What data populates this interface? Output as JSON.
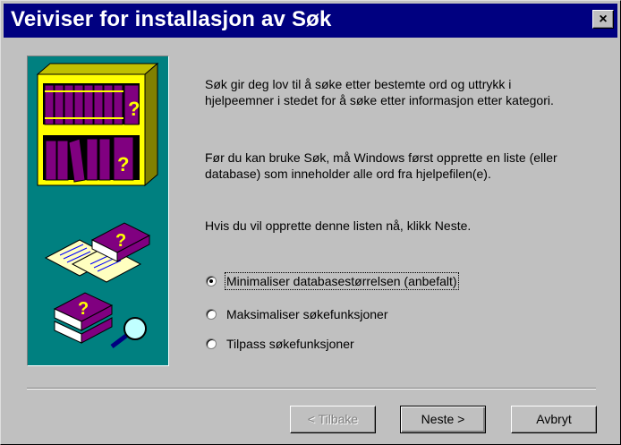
{
  "window": {
    "title": "Veiviser for installasjon av Søk",
    "close_symbol": "×"
  },
  "intro": {
    "paragraph1": "Søk gir deg lov til å søke etter bestemte ord og uttrykk i hjelpeemner i stedet for å søke etter informasjon etter kategori.",
    "paragraph2": "Før du kan bruke Søk, må Windows først opprette en liste (eller database) som inneholder alle ord fra hjelpefilen(e).",
    "paragraph3": "Hvis du vil opprette denne listen nå, klikk Neste."
  },
  "options": [
    {
      "label": "Minimaliser databasestørrelsen (anbefalt)",
      "checked": true
    },
    {
      "label": "Maksimaliser søkefunksjoner",
      "checked": false
    },
    {
      "label": "Tilpass søkefunksjoner",
      "checked": false
    }
  ],
  "buttons": {
    "back": "< Tilbake",
    "next": "Neste >",
    "cancel": "Avbryt"
  },
  "colors": {
    "titlebar": "#000080",
    "art_background": "#008080",
    "book": "#800080"
  }
}
